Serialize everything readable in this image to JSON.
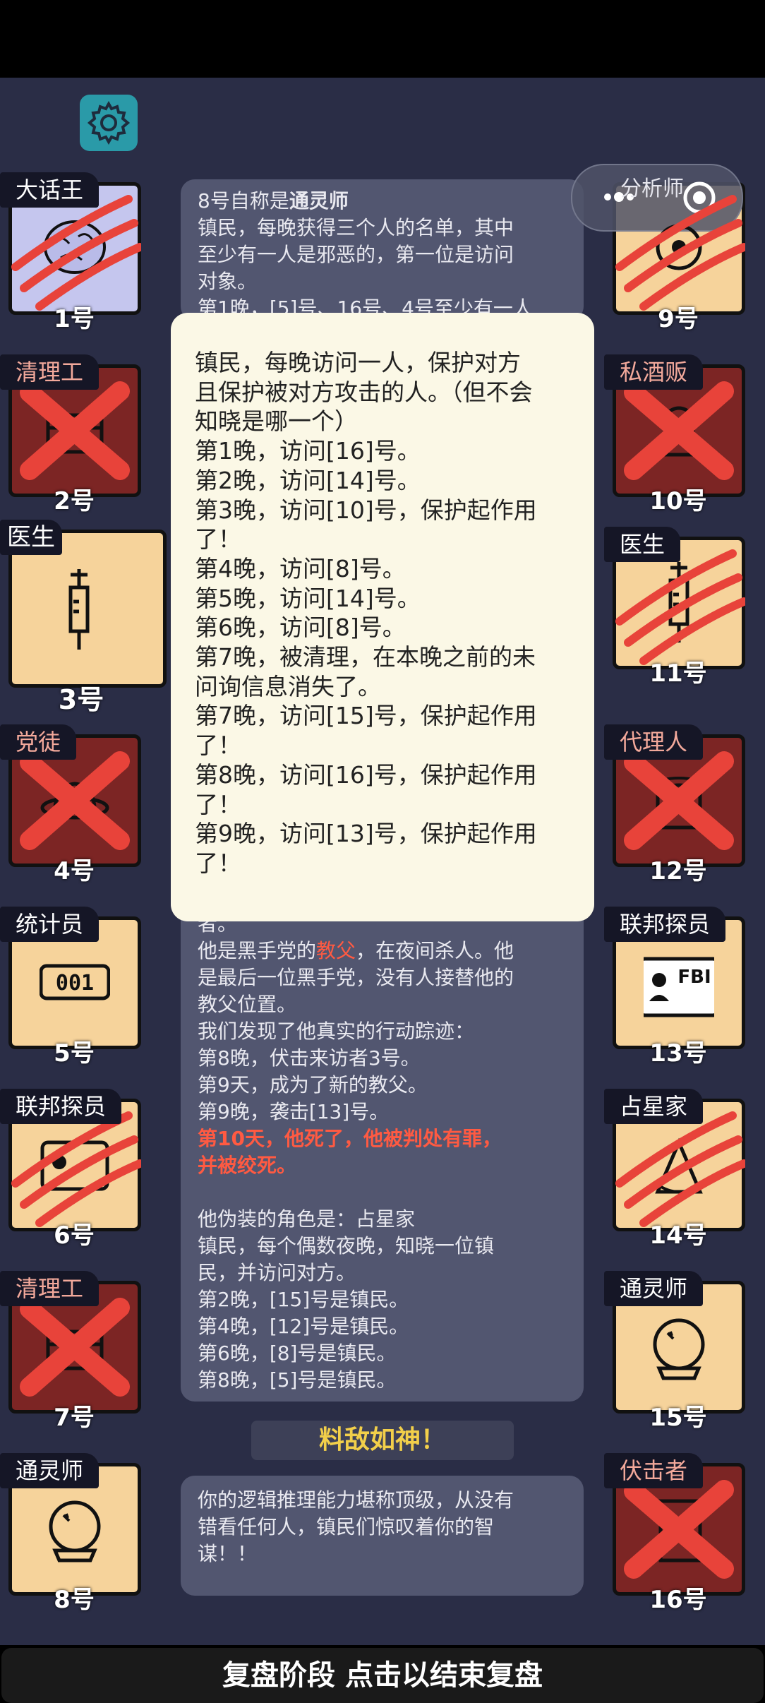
{
  "header": {
    "settings_icon": "gear-icon"
  },
  "analysis": {
    "label": "分析师",
    "icons": [
      "more-dots-icon",
      "record-ring-icon"
    ]
  },
  "players_left": [
    {
      "num": "1号",
      "role": "大话王",
      "state": "clawed",
      "icon": "brain-icon"
    },
    {
      "num": "2号",
      "role": "清理工",
      "state": "crossed",
      "icon": "chest-icon"
    },
    {
      "num": "3号",
      "role": "医生",
      "state": "alive",
      "icon": "syringe-icon"
    },
    {
      "num": "4号",
      "role": "党徒",
      "state": "crossed",
      "icon": "hat-icon"
    },
    {
      "num": "5号",
      "role": "统计员",
      "state": "alive",
      "icon": "counter-icon",
      "counter": "001"
    },
    {
      "num": "6号",
      "role": "联邦探员",
      "state": "clawed",
      "icon": "badge-icon"
    },
    {
      "num": "7号",
      "role": "清理工",
      "state": "crossed",
      "icon": "chest-icon"
    },
    {
      "num": "8号",
      "role": "通灵师",
      "state": "alive",
      "icon": "crystal-ball-icon"
    }
  ],
  "players_right": [
    {
      "num": "9号",
      "role": "",
      "state": "clawed",
      "icon": "gear-person-icon"
    },
    {
      "num": "10号",
      "role": "私酒贩",
      "state": "crossed",
      "icon": "bottle-icon"
    },
    {
      "num": "11号",
      "role": "医生",
      "state": "clawed",
      "icon": "syringe-icon"
    },
    {
      "num": "12号",
      "role": "代理人",
      "state": "crossed",
      "icon": "coat-icon"
    },
    {
      "num": "13号",
      "role": "联邦探员",
      "state": "alive",
      "icon": "fbi-badge-icon",
      "badge_text": "FBI"
    },
    {
      "num": "14号",
      "role": "占星家",
      "state": "clawed",
      "icon": "sextant-icon"
    },
    {
      "num": "15号",
      "role": "通灵师",
      "state": "alive",
      "icon": "crystal-ball-icon"
    },
    {
      "num": "16号",
      "role": "伏击者",
      "state": "crossed",
      "icon": "door-icon"
    }
  ],
  "top_info": [
    {
      "pre": "8号自称是",
      "bold": "通灵师"
    },
    {
      "text": "镇民，每晚获得三个人的名单，其中"
    },
    {
      "text": "至少有一人是邪恶的，第一位是访问"
    },
    {
      "text": "对象。"
    },
    {
      "text": "第1晚，[5]号、16号、4号至少有一人"
    }
  ],
  "popup": {
    "lines": [
      "镇民，每晚访问一人，保护对方",
      "且保护被对方攻击的人。（但不会",
      "知晓是哪一个）",
      "第1晚，访问[16]号。",
      "第2晚，访问[14]号。",
      "第3晚，访问[10]号，保护起作用",
      "了！",
      "第4晚，访问[8]号。",
      "第5晚，访问[14]号。",
      "第6晚，访问[8]号。",
      "第7晚，被清理，在本晚之前的未",
      "问询信息消失了。",
      "第7晚，访问[15]号，保护起作用",
      "了！",
      "第8晚，访问[16]号，保护起作用",
      "了！",
      "第9晚，访问[13]号，保护起作用",
      "了！"
    ]
  },
  "mid_info": {
    "line0": "者。",
    "line1_pre": "他是黑手党的",
    "line1_role": "教父",
    "line1_post": "，在夜间杀人。他",
    "lines": [
      "是最后一位黑手党，没有人接替他的",
      "教父位置。",
      "我们发现了他真实的行动踪迹：",
      "第8晚，伏击来访者3号。",
      "第9天，成为了新的教父。",
      "第9晚，袭击[13]号。"
    ],
    "highlight": [
      "第10天，他死了，他被判处有罪，",
      "并被绞死。"
    ],
    "disguise": [
      "他伪装的角色是：占星家",
      "镇民，每个偶数夜晚，知晓一位镇",
      "民，并访问对方。",
      "第2晚，[15]号是镇民。",
      "第4晚，[12]号是镇民。",
      "第6晚，[8]号是镇民。",
      "第8晚，[5]号是镇民。"
    ]
  },
  "result": {
    "title": "料敌如神！",
    "lines": [
      "你的逻辑推理能力堪称顶级，从没有",
      "错看任何人，镇民们惊叹着你的智",
      "谋！！"
    ]
  },
  "footer": {
    "label": "复盘阶段 点击以结束复盘"
  },
  "colors": {
    "background": "#2a2d46",
    "alive": "#f6d39b",
    "dead": "#7c2524",
    "accent": "#ff5a42",
    "gold": "#f2cf4a"
  }
}
